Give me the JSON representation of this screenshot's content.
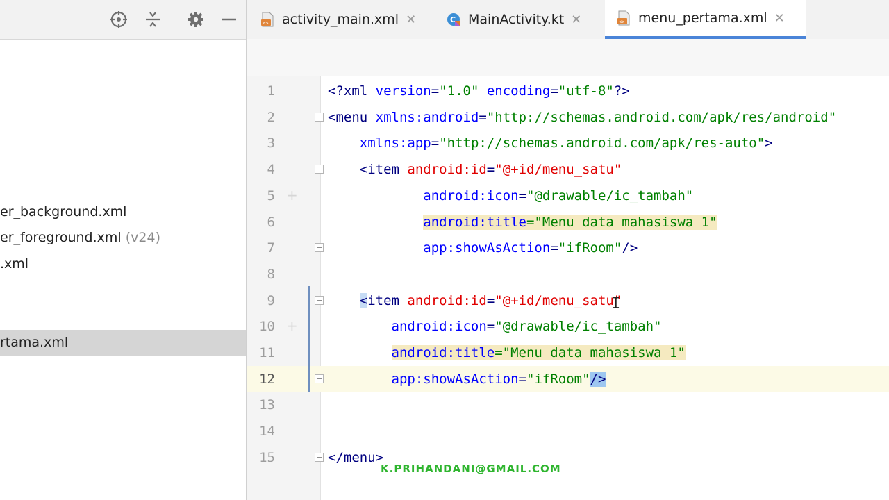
{
  "project": {
    "toolbar_icons": [
      "crosshair-icon",
      "collapse-icon",
      "gear-icon",
      "minimize-icon"
    ],
    "files": [
      {
        "name": "er_background.xml",
        "qualifier": "",
        "selected": false
      },
      {
        "name": "er_foreground.xml",
        "qualifier": "(v24)",
        "selected": false
      },
      {
        "name": ".xml",
        "qualifier": "",
        "selected": false
      },
      {
        "name": "rtama.xml",
        "qualifier": "",
        "selected": true
      }
    ]
  },
  "tabs": [
    {
      "label": "activity_main.xml",
      "icon": "xml-file-icon",
      "close": "✕",
      "active": false
    },
    {
      "label": "MainActivity.kt",
      "icon": "kotlin-file-icon",
      "close": "✕",
      "active": false
    },
    {
      "label": "menu_pertama.xml",
      "icon": "xml-file-icon",
      "close": "✕",
      "active": true
    }
  ],
  "editor": {
    "current_line": 12,
    "lines": [
      {
        "n": "1",
        "tokens": [
          [
            "<?",
            "tk-punct"
          ],
          [
            "xml ",
            "tk-tag"
          ],
          [
            "version",
            "tk-attr"
          ],
          [
            "=",
            "tk-punct"
          ],
          [
            "\"1.0\" ",
            "tk-val"
          ],
          [
            "encoding",
            "tk-attr"
          ],
          [
            "=",
            "tk-punct"
          ],
          [
            "\"utf-8\"",
            "tk-val"
          ],
          [
            "?>",
            "tk-punct"
          ]
        ]
      },
      {
        "n": "2",
        "tokens": [
          [
            "<menu ",
            "tk-tag"
          ],
          [
            "xmlns:",
            "tk-attr"
          ],
          [
            "android",
            "tk-attr"
          ],
          [
            "=",
            "tk-punct"
          ],
          [
            "\"http://schemas.android.com/apk/res/android\"",
            "tk-val"
          ]
        ]
      },
      {
        "n": "3",
        "tokens": [
          [
            "    ",
            ""
          ],
          [
            "xmlns:",
            "tk-attr"
          ],
          [
            "app",
            "tk-attr"
          ],
          [
            "=",
            "tk-punct"
          ],
          [
            "\"http://schemas.android.com/apk/res-auto\"",
            "tk-val"
          ],
          [
            ">",
            "tk-punct"
          ]
        ]
      },
      {
        "n": "4",
        "tokens": [
          [
            "    ",
            ""
          ],
          [
            "<item ",
            "tk-tag"
          ],
          [
            "android:id",
            "tk-attr-red"
          ],
          [
            "=",
            "tk-punct"
          ],
          [
            "\"@+id/menu_satu\"",
            "tk-attr-red"
          ]
        ]
      },
      {
        "n": "5",
        "tokens": [
          [
            "            ",
            ""
          ],
          [
            "android:icon",
            "tk-attr"
          ],
          [
            "=",
            "tk-punct"
          ],
          [
            "\"@drawable/ic_tambah\"",
            "tk-val"
          ]
        ]
      },
      {
        "n": "6",
        "tokens": [
          [
            "            ",
            ""
          ],
          [
            "android:title",
            "tk-attr hl-attr"
          ],
          [
            "=\"Menu data mahasiswa 1\"",
            "tk-val hl-attr"
          ]
        ]
      },
      {
        "n": "7",
        "tokens": [
          [
            "            ",
            ""
          ],
          [
            "app:showAsAction",
            "tk-attr"
          ],
          [
            "=",
            "tk-punct"
          ],
          [
            "\"ifRoom\"",
            "tk-val"
          ],
          [
            "/>",
            "tk-punct"
          ]
        ]
      },
      {
        "n": "8",
        "tokens": [
          [
            "",
            ""
          ]
        ]
      },
      {
        "n": "9",
        "tokens": [
          [
            "    ",
            ""
          ],
          [
            "<",
            "tk-tag hl-caret-bg"
          ],
          [
            "item ",
            "tk-tag"
          ],
          [
            "android:id",
            "tk-attr-red"
          ],
          [
            "=",
            "tk-punct"
          ],
          [
            "\"@+id/menu_satu\"",
            "tk-attr-red"
          ]
        ]
      },
      {
        "n": "10",
        "tokens": [
          [
            "        ",
            ""
          ],
          [
            "android:icon",
            "tk-attr"
          ],
          [
            "=",
            "tk-punct"
          ],
          [
            "\"@drawable/ic_tambah\"",
            "tk-val"
          ]
        ]
      },
      {
        "n": "11",
        "tokens": [
          [
            "        ",
            ""
          ],
          [
            "android:title",
            "tk-attr hl-attr"
          ],
          [
            "=\"Menu data mahasiswa 1\"",
            "tk-val hl-attr"
          ]
        ]
      },
      {
        "n": "12",
        "tokens": [
          [
            "        ",
            ""
          ],
          [
            "app:showAsAction",
            "tk-attr"
          ],
          [
            "=",
            "tk-punct"
          ],
          [
            "\"ifRoom\"",
            "tk-val"
          ],
          [
            "/>",
            "tk-punct hl-sel"
          ]
        ]
      },
      {
        "n": "13",
        "tokens": [
          [
            "",
            ""
          ]
        ]
      },
      {
        "n": "14",
        "tokens": [
          [
            "",
            ""
          ]
        ]
      },
      {
        "n": "15",
        "tokens": [
          [
            "</menu>",
            "tk-tag"
          ]
        ]
      }
    ]
  },
  "watermark": "K.PRIHANDANI@GMAIL.COM",
  "colors": {
    "accent": "#4a84d8",
    "attr": "#0000ff",
    "value": "#008000",
    "id": "#e00000",
    "tag": "#000080"
  }
}
